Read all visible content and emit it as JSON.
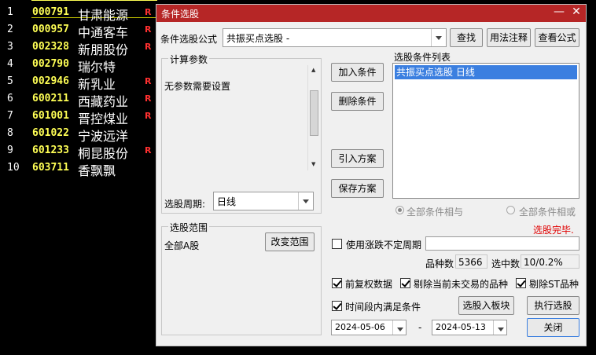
{
  "stocks": [
    {
      "idx": "1",
      "code": "000791",
      "name": "甘肃能源",
      "flag": "R"
    },
    {
      "idx": "2",
      "code": "000957",
      "name": "中通客车",
      "flag": "R"
    },
    {
      "idx": "3",
      "code": "002328",
      "name": "新朋股份",
      "flag": "R"
    },
    {
      "idx": "4",
      "code": "002790",
      "name": "瑞尔特",
      "flag": ""
    },
    {
      "idx": "5",
      "code": "002946",
      "name": "新乳业",
      "flag": "R"
    },
    {
      "idx": "6",
      "code": "600211",
      "name": "西藏药业",
      "flag": "R"
    },
    {
      "idx": "7",
      "code": "601001",
      "name": "晋控煤业",
      "flag": "R"
    },
    {
      "idx": "8",
      "code": "601022",
      "name": "宁波远洋",
      "flag": ""
    },
    {
      "idx": "9",
      "code": "601233",
      "name": "桐昆股份",
      "flag": "R"
    },
    {
      "idx": "10",
      "code": "603711",
      "name": "香飘飘",
      "flag": ""
    }
  ],
  "dialog": {
    "title": "条件选股",
    "minimize": "—",
    "close": "✕",
    "formula_label": "条件选股公式",
    "formula_value": "共振买点选股 -",
    "find_btn": "查找",
    "usage_btn": "用法注释",
    "view_formula_btn": "查看公式",
    "params_group": "计算参数",
    "params_text": "无参数需要设置",
    "period_label": "选股周期:",
    "period_value": "日线",
    "add_condition_btn": "加入条件",
    "delete_condition_btn": "删除条件",
    "import_plan_btn": "引入方案",
    "save_plan_btn": "保存方案",
    "condition_list_label": "选股条件列表",
    "condition_item": "共振买点选股  日线",
    "all_and_label": "全部条件相与",
    "all_or_label": "全部条件相或",
    "status_text": "选股完毕.",
    "range_group": "选股范围",
    "range_value": "全部A股",
    "change_range_btn": "改变范围",
    "use_period_label": "使用涨跌不定周期",
    "count_label": "品种数",
    "count_value": "5366",
    "selected_label": "选中数",
    "selected_value": "10/0.2%",
    "fq_label": "前复权数据",
    "exclude_untraded_label": "剔除当前未交易的品种",
    "exclude_st_label": "剔除ST品种",
    "time_range_label": "时间段内满足条件",
    "to_block_btn": "选股入板块",
    "execute_btn": "执行选股",
    "date_from": "2024-05-06",
    "date_sep": "-",
    "date_to": "2024-05-13",
    "close_btn": "关闭"
  }
}
